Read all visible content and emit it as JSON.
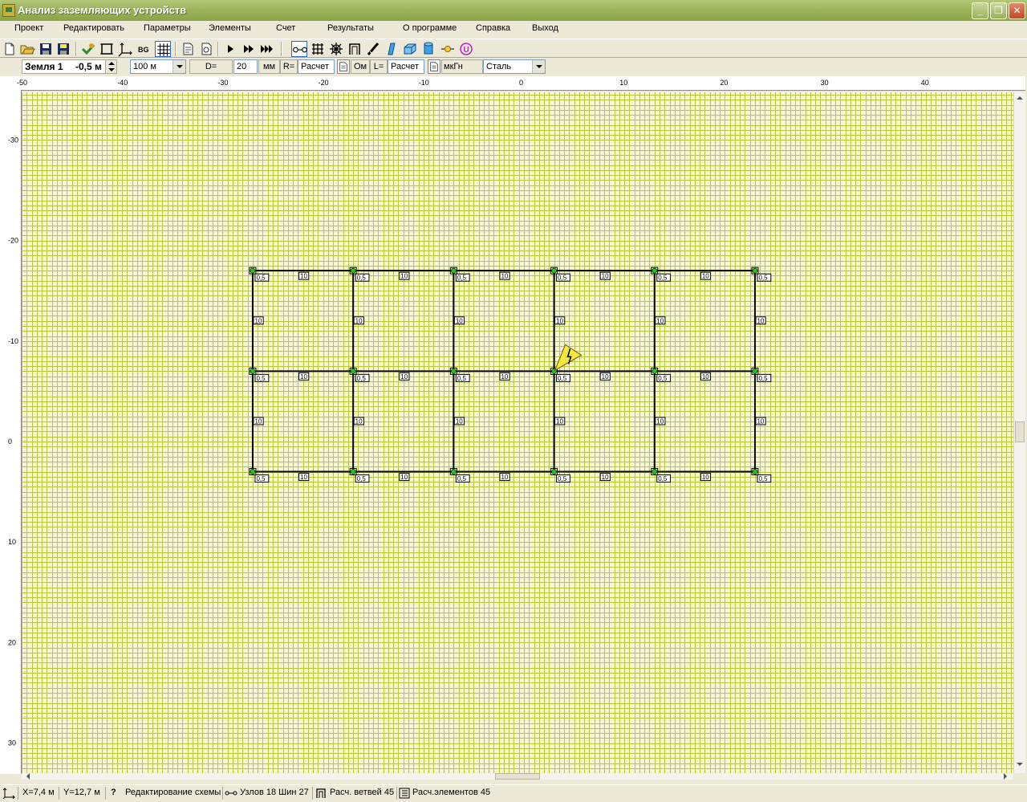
{
  "window": {
    "title": "Анализ заземляющих устройств",
    "controls": [
      "minimize",
      "maximize",
      "close"
    ]
  },
  "menu": [
    "Проект",
    "Редактировать",
    "Параметры",
    "Элементы",
    "Счет",
    "Результаты",
    "О программе",
    "Справка",
    "Выход"
  ],
  "toolbar": {
    "buttons": [
      "new-file",
      "open-folder",
      "save",
      "save-as",
      "add-node",
      "frame",
      "axes",
      "bg",
      "grid",
      "page",
      "page-preview",
      "run",
      "run-fast",
      "run-all",
      "link-bus",
      "mesh",
      "star",
      "bracket",
      "electrode",
      "plate",
      "box",
      "cylinder",
      "probe",
      "voltage-source"
    ],
    "bg_label": "BG"
  },
  "params": {
    "layer": "Земля 1",
    "depth": "-0,5 м",
    "length": "100 м",
    "d_label": "D=",
    "d_value": "20",
    "d_unit": "мм",
    "r_label": "R=",
    "r_value": "Расчет",
    "ohm_label": "Ом",
    "l_label": "L=",
    "l_value": "Расчет",
    "l_unit": "мкГн",
    "material": "Сталь"
  },
  "rulers": {
    "top": [
      "-50",
      "-40",
      "-30",
      "-20",
      "-10",
      "0",
      "10",
      "20",
      "30",
      "40"
    ],
    "left": [
      "-30",
      "-20",
      "-10",
      "0",
      "10",
      "20",
      "30"
    ]
  },
  "scheme": {
    "grid_color": "#b7c93a",
    "background": "#f5f5d0",
    "wire_color": "#000000",
    "node_color": "#22c022",
    "node_label": "0,5",
    "segment_label": "10",
    "columns_x_m": [
      -27,
      -17,
      -7,
      3,
      13,
      23
    ],
    "rows_y_m": [
      -17,
      -7,
      3
    ],
    "source_marker_x_m": 3,
    "source_marker_y_m": -7
  },
  "status": {
    "x": "X=7,4 м",
    "y": "Y=12,7 м",
    "mode": "Редактирование схемы",
    "nodes_buses": "Узлов 18 Шин 27",
    "branches": "Расч. ветвей 45",
    "elements": "Расч.элементов 45"
  }
}
